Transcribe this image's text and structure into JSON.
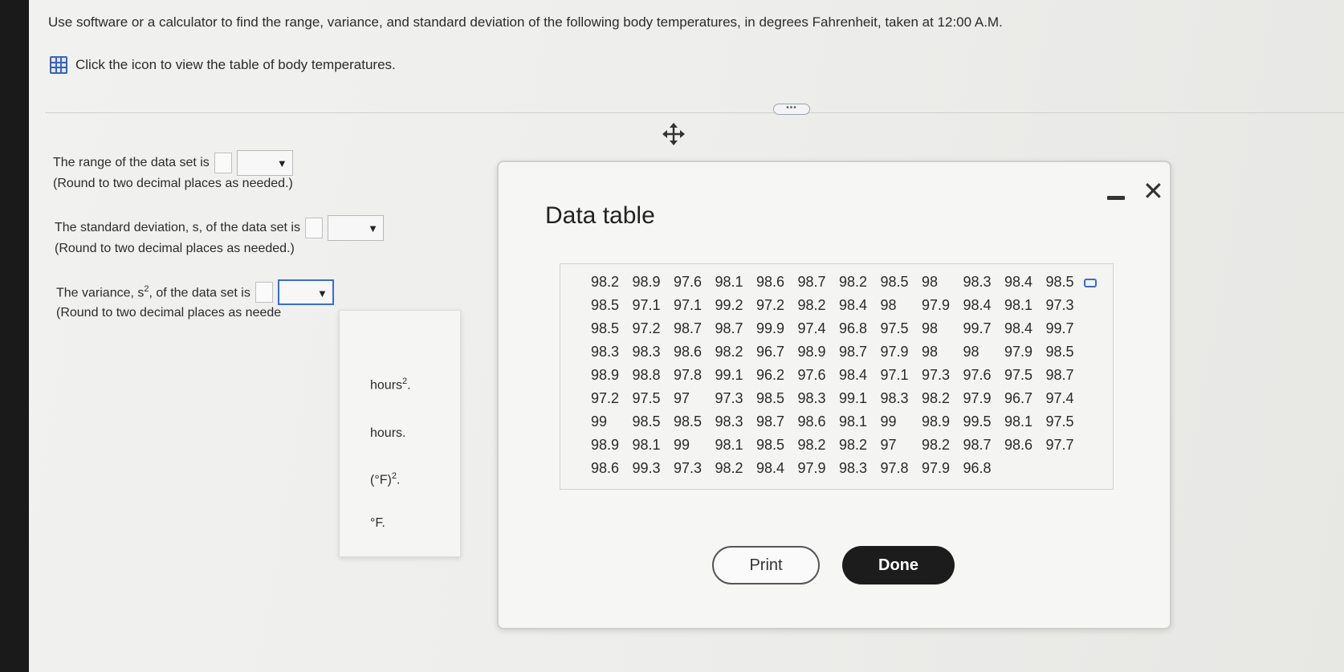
{
  "question": {
    "text": "Use software or a calculator to find the range, variance, and standard deviation of the following body temperatures, in degrees Fahrenheit, taken at 12:00 A.M.",
    "table_link": "Click the icon to view the table of body temperatures."
  },
  "divider": {
    "more_label": "•••"
  },
  "answers": {
    "range": {
      "label": "The range of the data set is",
      "hint": "(Round to two decimal places as needed.)"
    },
    "stdev": {
      "label": "The standard deviation, s, of the data set is",
      "hint": "(Round to two decimal places as needed.)"
    },
    "variance": {
      "label_pre": "The variance, s",
      "label_sup": "2",
      "label_post": ", of the data set is",
      "hint": "(Round to two decimal places as neede"
    }
  },
  "dropdown": {
    "options": [
      {
        "base": "hours",
        "sup": "2",
        "tail": "."
      },
      {
        "base": "hours.",
        "sup": "",
        "tail": ""
      },
      {
        "base": "(°F)",
        "sup": "2",
        "tail": "."
      },
      {
        "base": "°F.",
        "sup": "",
        "tail": ""
      }
    ]
  },
  "modal": {
    "title": "Data table",
    "print_label": "Print",
    "done_label": "Done",
    "rows": [
      [
        "98.2",
        "98.9",
        "97.6",
        "98.1",
        "98.6",
        "98.7",
        "98.2",
        "98.5",
        "98",
        "98.3",
        "98.4",
        "98.5"
      ],
      [
        "98.5",
        "97.1",
        "97.1",
        "99.2",
        "97.2",
        "98.2",
        "98.4",
        "98",
        "97.9",
        "98.4",
        "98.1",
        "97.3"
      ],
      [
        "98.5",
        "97.2",
        "98.7",
        "98.7",
        "99.9",
        "97.4",
        "96.8",
        "97.5",
        "98",
        "99.7",
        "98.4",
        "99.7"
      ],
      [
        "98.3",
        "98.3",
        "98.6",
        "98.2",
        "96.7",
        "98.9",
        "98.7",
        "97.9",
        "98",
        "98",
        "97.9",
        "98.5"
      ],
      [
        "98.9",
        "98.8",
        "97.8",
        "99.1",
        "96.2",
        "97.6",
        "98.4",
        "97.1",
        "97.3",
        "97.6",
        "97.5",
        "98.7"
      ],
      [
        "97.2",
        "97.5",
        "97",
        "97.3",
        "98.5",
        "98.3",
        "99.1",
        "98.3",
        "98.2",
        "97.9",
        "96.7",
        "97.4"
      ],
      [
        "99",
        "98.5",
        "98.5",
        "98.3",
        "98.7",
        "98.6",
        "98.1",
        "99",
        "98.9",
        "99.5",
        "98.1",
        "97.5"
      ],
      [
        "98.9",
        "98.1",
        "99",
        "98.1",
        "98.5",
        "98.2",
        "98.2",
        "97",
        "98.2",
        "98.7",
        "98.6",
        "97.7"
      ],
      [
        "98.6",
        "99.3",
        "97.3",
        "98.2",
        "98.4",
        "97.9",
        "98.3",
        "97.8",
        "97.9",
        "96.8"
      ]
    ]
  }
}
